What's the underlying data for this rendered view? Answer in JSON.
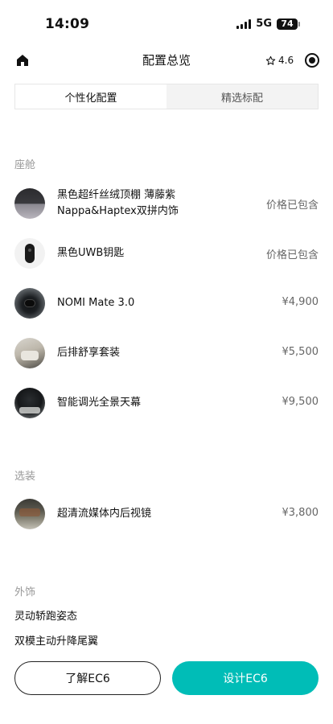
{
  "status": {
    "time": "14:09",
    "network": "5G",
    "battery": "74"
  },
  "nav": {
    "title": "配置总览",
    "rating": "4.6"
  },
  "tabs": [
    {
      "label": "个性化配置",
      "active": true
    },
    {
      "label": "精选标配",
      "active": false
    }
  ],
  "sections": {
    "cabin": {
      "title": "座舱",
      "items": [
        {
          "label": "黑色超纤丝绒顶棚 薄藤紫Nappa&Haptex双拼内饰",
          "price": "价格已包含"
        },
        {
          "label": "黑色UWB钥匙",
          "price": "价格已包含"
        },
        {
          "label": "NOMI Mate 3.0",
          "price": "¥4,900"
        },
        {
          "label": "后排舒享套装",
          "price": "¥5,500"
        },
        {
          "label": "智能调光全景天幕",
          "price": "¥9,500"
        }
      ]
    },
    "options": {
      "title": "选装",
      "items": [
        {
          "label": "超清流媒体内后视镜",
          "price": "¥3,800"
        }
      ]
    },
    "exterior": {
      "title": "外饰",
      "lines": [
        "灵动轿跑姿态",
        "双模主动升降尾翼"
      ]
    }
  },
  "buttons": {
    "learn": "了解EC6",
    "design": "设计EC6"
  },
  "colors": {
    "accent": "#00bdb7"
  }
}
